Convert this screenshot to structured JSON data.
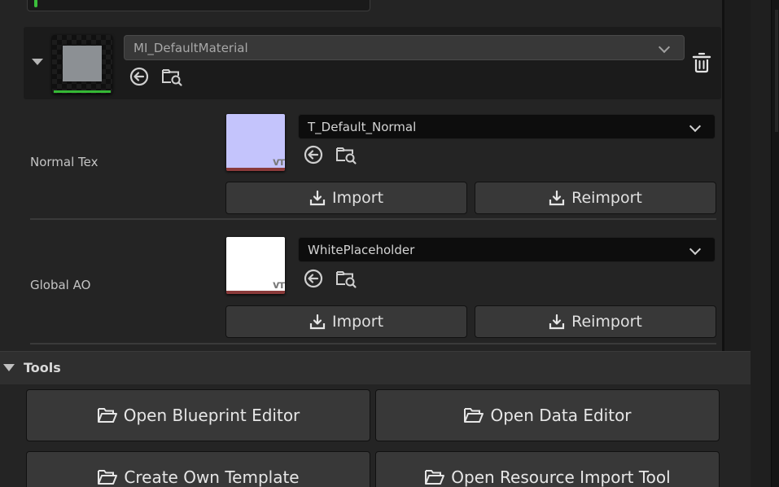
{
  "material": {
    "selected": "MI_DefaultMaterial"
  },
  "rows": [
    {
      "label": "Normal Tex",
      "texture": "T_Default_Normal",
      "thumb_color": "#c4c4fc",
      "thumb_badge": "vт",
      "import_label": "Import",
      "reimport_label": "Reimport"
    },
    {
      "label": "Global AO",
      "texture": "WhitePlaceholder",
      "thumb_color": "#ffffff",
      "thumb_badge": "vт",
      "import_label": "Import",
      "reimport_label": "Reimport"
    }
  ],
  "tools": {
    "title": "Tools",
    "buttons": [
      "Open Blueprint Editor",
      "Open Data Editor",
      "Create Own Template",
      "Open Resource Import Tool"
    ]
  },
  "icons": {
    "use_selected": "arrow-left-circle-icon",
    "browse": "folder-search-icon",
    "delete": "trash-icon",
    "import": "download-tray-icon",
    "folder": "folder-open-icon"
  },
  "colors": {
    "panel_bg": "#242424",
    "button_bg": "#383838",
    "accent_green": "#35b835",
    "thumb_underline": "#8a3a3a"
  }
}
